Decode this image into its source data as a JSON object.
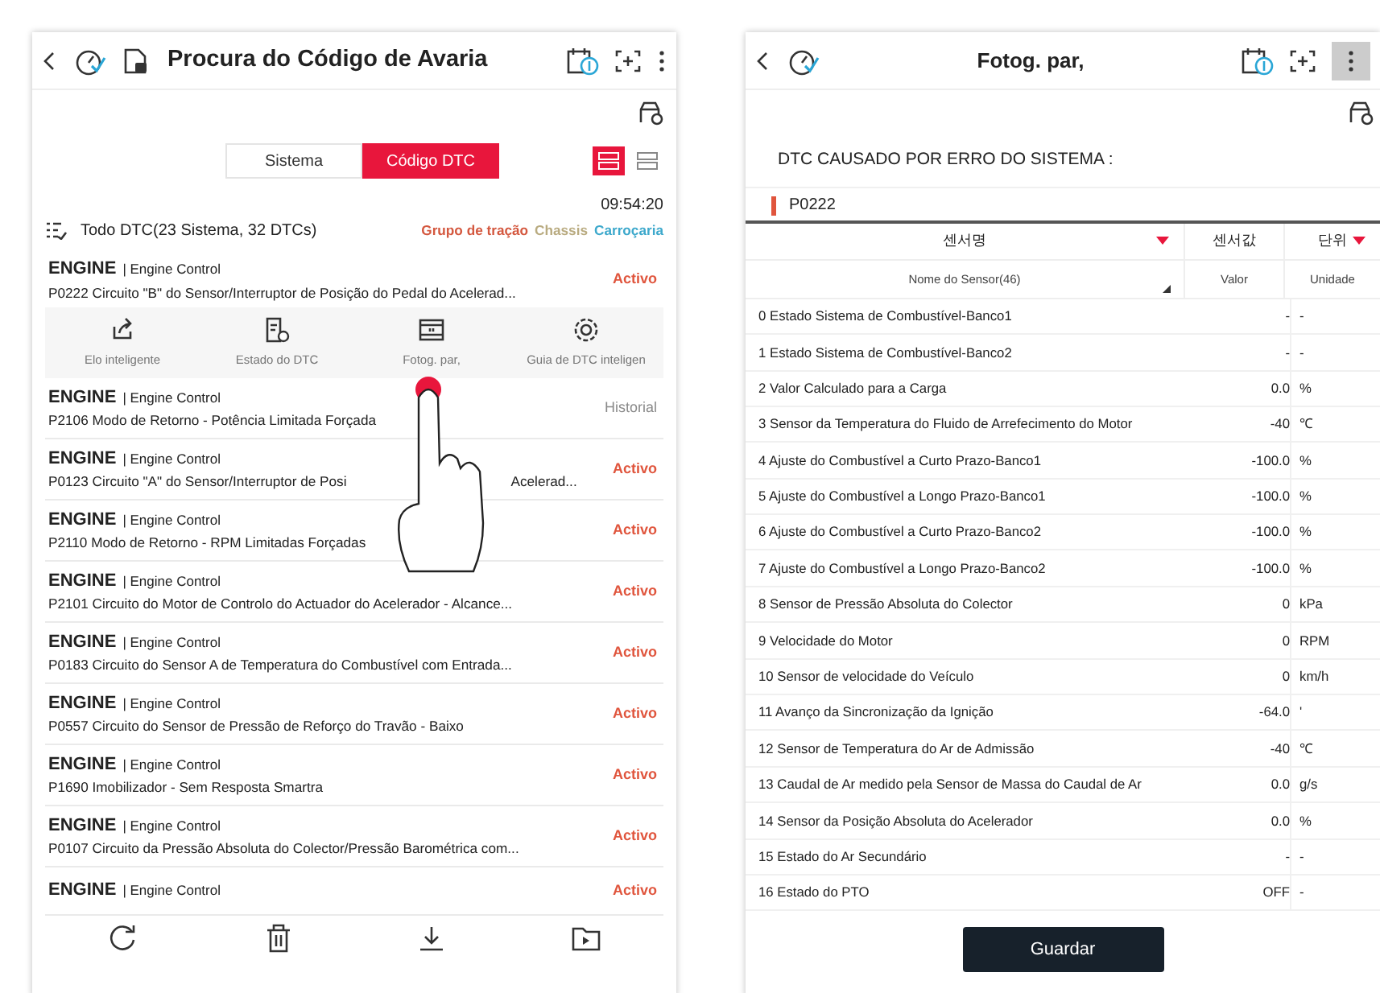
{
  "left": {
    "title": "Procura do Código de Avaria",
    "tabs": [
      {
        "label": "Sistema",
        "selected": false
      },
      {
        "label": "Código DTC",
        "selected": true
      }
    ],
    "view_modes": [
      {
        "selected": true
      },
      {
        "selected": false
      }
    ],
    "time": "09:54:20",
    "summary": "Todo DTC(23 Sistema, 32 DTCs)",
    "filters": [
      {
        "label": "Grupo de tração",
        "color": "#d4583f"
      },
      {
        "label": "Chassis",
        "color": "#b9ab80"
      },
      {
        "label": "Carroçaria",
        "color": "#3ea9cc"
      }
    ],
    "actions": [
      "Elo inteligente",
      "Estado do DTC",
      "Fotog. par,",
      "Guia de DTC inteligen"
    ],
    "dtcs": [
      {
        "system": "ENGINE",
        "module": "| Engine Control",
        "desc": "P0222 Circuito \"B\" do Sensor/Interruptor de Posição do Pedal do Acelerad...",
        "status": "Activo",
        "kind": "active",
        "expanded": true
      },
      {
        "system": "ENGINE",
        "module": "| Engine Control",
        "desc": "P2106 Modo de Retorno - Potência Limitada Forçada",
        "status": "Historial",
        "kind": "history",
        "expanded": false
      },
      {
        "system": "ENGINE",
        "module": "| Engine Control",
        "desc": "P0123 Circuito \"A\" do Sensor/Interruptor de Posi",
        "desc_after": "Acelerad...",
        "status": "Activo",
        "kind": "active",
        "expanded": false
      },
      {
        "system": "ENGINE",
        "module": "| Engine Control",
        "desc": "P2110 Modo de Retorno - RPM Limitadas Forçadas",
        "status": "Activo",
        "kind": "active",
        "expanded": false
      },
      {
        "system": "ENGINE",
        "module": "| Engine Control",
        "desc": "P2101 Circuito do Motor de Controlo do Actuador do Acelerador - Alcance...",
        "status": "Activo",
        "kind": "active",
        "expanded": false
      },
      {
        "system": "ENGINE",
        "module": "| Engine Control",
        "desc": "P0183 Circuito do Sensor A de Temperatura do Combustível com Entrada...",
        "status": "Activo",
        "kind": "active",
        "expanded": false
      },
      {
        "system": "ENGINE",
        "module": "| Engine Control",
        "desc": "P0557 Circuito do Sensor de Pressão de Reforço do Travão - Baixo",
        "status": "Activo",
        "kind": "active",
        "expanded": false
      },
      {
        "system": "ENGINE",
        "module": "| Engine Control",
        "desc": "P1690 Imobilizador - Sem Resposta Smartra",
        "status": "Activo",
        "kind": "active",
        "expanded": false
      },
      {
        "system": "ENGINE",
        "module": "| Engine Control",
        "desc": "P0107 Circuito da Pressão Absoluta do Colector/Pressão Barométrica com...",
        "status": "Activo",
        "kind": "active",
        "expanded": false
      },
      {
        "system": "ENGINE",
        "module": "| Engine Control",
        "status": "Activo",
        "kind": "active",
        "expanded": false
      }
    ]
  },
  "right": {
    "title": "Fotog. par,",
    "caption": "DTC CAUSADO POR ERRO DO SISTEMA :",
    "code": "P0222",
    "header_kr": [
      "센서명",
      "센서값",
      "단위"
    ],
    "columns": [
      "Nome do Sensor(46)",
      "Valor",
      "Unidade"
    ],
    "rows": [
      {
        "name": "0 Estado Sistema de Combustível-Banco1",
        "value": "-",
        "unit": "-"
      },
      {
        "name": "1 Estado Sistema de Combustível-Banco2",
        "value": "-",
        "unit": "-"
      },
      {
        "name": "2 Valor Calculado para a Carga",
        "value": "0.0",
        "unit": "%"
      },
      {
        "name": "3 Sensor da Temperatura do Fluido de Arrefecimento do Motor",
        "value": "-40",
        "unit": "℃"
      },
      {
        "name": "4 Ajuste do Combustível a Curto Prazo-Banco1",
        "value": "-100.0",
        "unit": "%"
      },
      {
        "name": "5 Ajuste do Combustível a Longo Prazo-Banco1",
        "value": "-100.0",
        "unit": "%"
      },
      {
        "name": "6 Ajuste do Combustível a Curto Prazo-Banco2",
        "value": "-100.0",
        "unit": "%"
      },
      {
        "name": "7 Ajuste do Combustível a Longo Prazo-Banco2",
        "value": "-100.0",
        "unit": "%"
      },
      {
        "name": "8 Sensor de Pressão Absoluta do Colector",
        "value": "0",
        "unit": "kPa"
      },
      {
        "name": "9 Velocidade do Motor",
        "value": "0",
        "unit": "RPM"
      },
      {
        "name": "10 Sensor de velocidade do Veículo",
        "value": "0",
        "unit": "km/h"
      },
      {
        "name": "11 Avanço da Sincronização da Ignição",
        "value": "-64.0",
        "unit": "'"
      },
      {
        "name": "12 Sensor de Temperatura do Ar de Admissão",
        "value": "-40",
        "unit": "℃"
      },
      {
        "name": "13 Caudal de Ar medido pela Sensor de Massa do Caudal de Ar",
        "value": "0.0",
        "unit": "g/s"
      },
      {
        "name": "14 Sensor da Posição Absoluta do Acelerador",
        "value": "0.0",
        "unit": "%"
      },
      {
        "name": "15 Estado do Ar Secundário",
        "value": "-",
        "unit": "-"
      },
      {
        "name": "16 Estado do PTO",
        "value": "OFF",
        "unit": "-"
      }
    ],
    "button": "Guardar"
  }
}
